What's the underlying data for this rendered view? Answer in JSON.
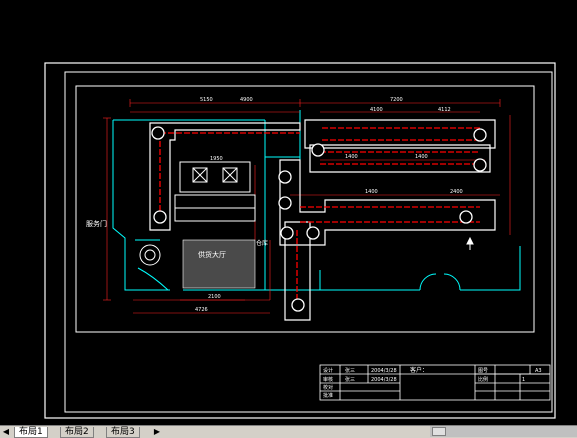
{
  "drawing": {
    "left_label": "服务门",
    "center_label": "供货大厅",
    "right_small_label": "仓库",
    "top_dims": [
      "5150",
      "4900",
      "7200"
    ],
    "row2_dims": [
      "4100",
      "4112"
    ],
    "bottom_dims": [
      "2100",
      "4726"
    ],
    "mid_dims": [
      "1950",
      "1400"
    ],
    "right_dims": [
      "2400",
      "1400",
      "1400"
    ]
  },
  "title_block": {
    "r1c1": "设计",
    "r1c2": "张三",
    "r1c3": "2004/3/28",
    "r1c4": "客户：",
    "r1c5": "图号",
    "r1c6": "A3",
    "r2c1": "审核",
    "r2c2": "张三",
    "r2c3": "2004/3/28",
    "r2c5": "比例",
    "r2c6": "1",
    "r3c1": "校对",
    "r4c1": "批准"
  },
  "layout_tabs": {
    "tab1": "布局1",
    "tab2": "布局2",
    "tab3": "布局3",
    "nav_prev": "◀",
    "nav_next": "▶"
  }
}
